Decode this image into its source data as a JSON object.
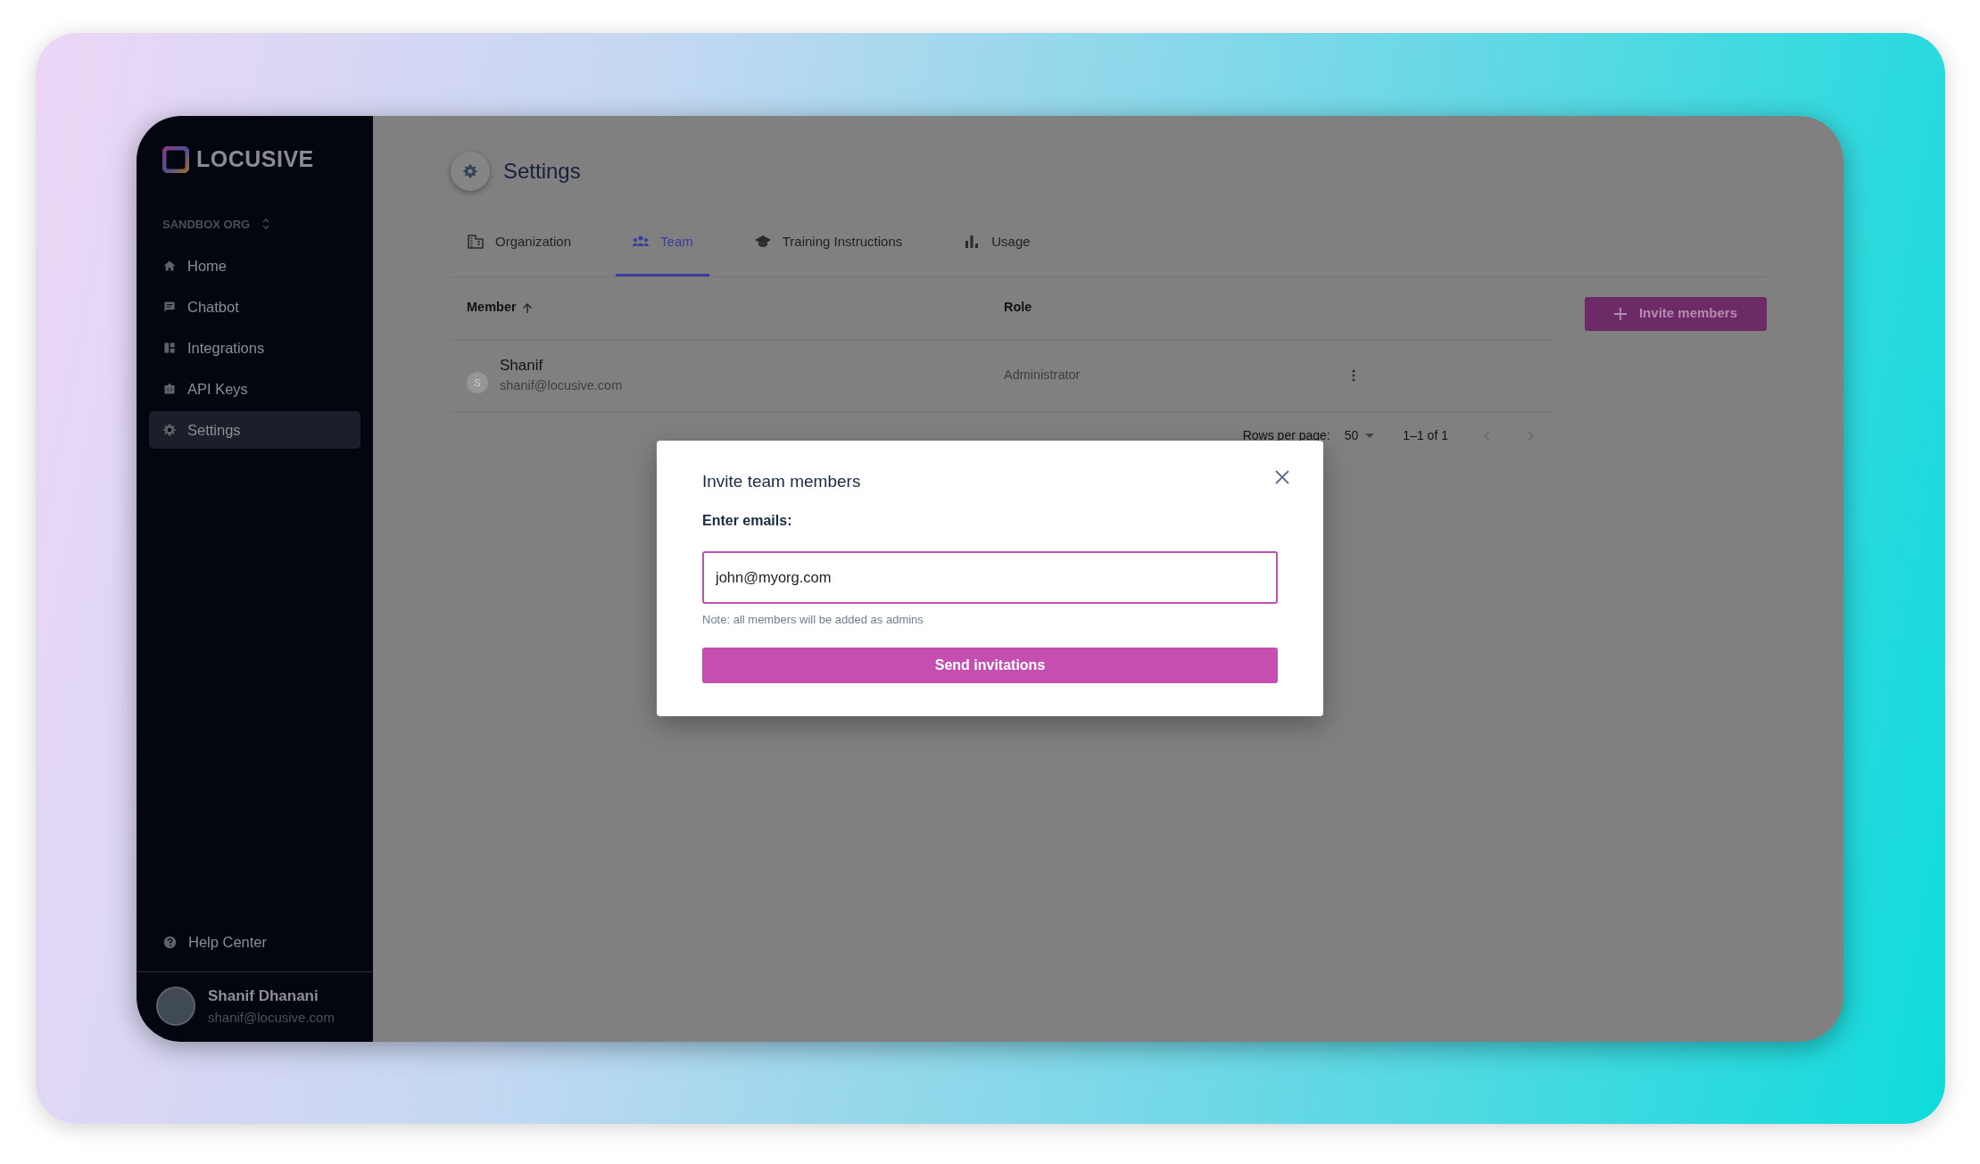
{
  "sidebar": {
    "brand": "LOCUSIVE",
    "org": "SANDBOX ORG",
    "items": [
      {
        "kind": "home",
        "label": "Home",
        "selected": false
      },
      {
        "kind": "chat",
        "label": "Chatbot",
        "selected": false
      },
      {
        "kind": "dashboard",
        "label": "Integrations",
        "selected": false
      },
      {
        "kind": "api",
        "label": "API Keys",
        "selected": false
      },
      {
        "kind": "gear",
        "label": "Settings",
        "selected": true
      }
    ],
    "help": "Help Center",
    "user": {
      "name": "Shanif Dhanani",
      "email": "shanif@locusive.com"
    }
  },
  "page": {
    "title": "Settings"
  },
  "tabs": [
    {
      "kind": "building",
      "label": "Organization",
      "selected": false
    },
    {
      "kind": "people",
      "label": "Team",
      "selected": true
    },
    {
      "kind": "school",
      "label": "Training Instructions",
      "selected": false
    },
    {
      "kind": "chart",
      "label": "Usage",
      "selected": false
    }
  ],
  "table": {
    "columns": [
      {
        "label": "Member",
        "sorted": true
      },
      {
        "label": "Role",
        "sorted": false
      }
    ],
    "rows": [
      {
        "initial": "S",
        "name": "Shanif",
        "email": "shanif@locusive.com",
        "role": "Administrator"
      }
    ]
  },
  "invite_button": "Invite members",
  "pagination": {
    "rows_label": "Rows per page:",
    "rows_value": "50",
    "range": "1–1 of 1"
  },
  "dialog": {
    "title": "Invite team members",
    "label": "Enter emails:",
    "value": "john@myorg.com",
    "note": "Note: all members will be added as admins",
    "submit": "Send invitations"
  }
}
